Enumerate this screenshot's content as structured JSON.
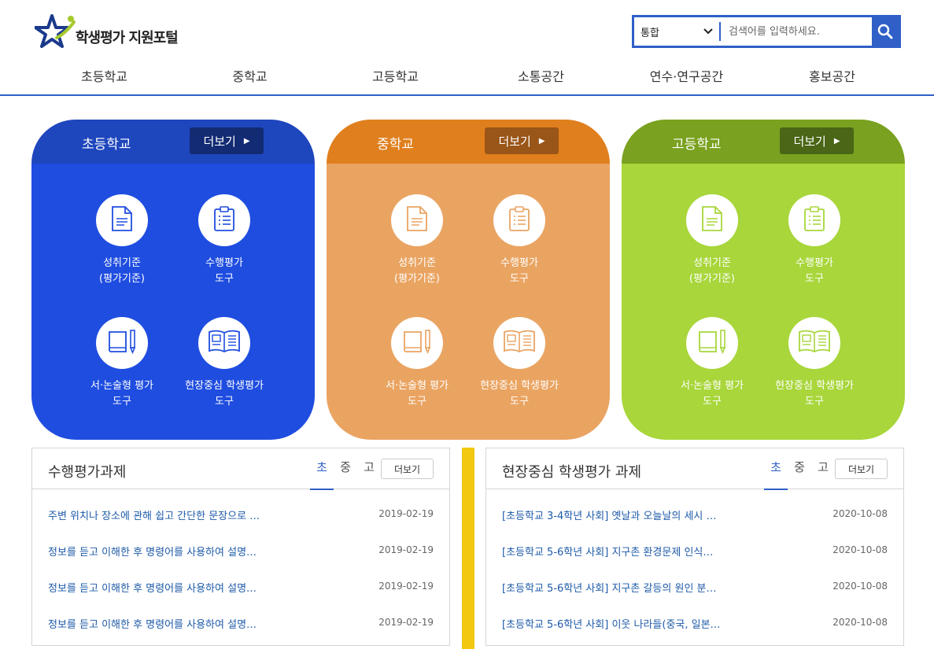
{
  "header": {
    "logo_text": "학생평가 지원포털",
    "search": {
      "category": "통합",
      "placeholder": "검색어를 입력하세요."
    }
  },
  "nav": [
    "초등학교",
    "중학교",
    "고등학교",
    "소통공간",
    "연수·연구공간",
    "홍보공간"
  ],
  "cards": [
    {
      "title": "초등학교",
      "more": "더보기",
      "tiles": [
        {
          "line1": "성취기준",
          "line2": "(평가기준)"
        },
        {
          "line1": "수행평가",
          "line2": "도구"
        },
        {
          "line1": "서·논술형 평가",
          "line2": "도구"
        },
        {
          "line1": "현장중심 학생평가",
          "line2": "도구"
        }
      ]
    },
    {
      "title": "중학교",
      "more": "더보기",
      "tiles": [
        {
          "line1": "성취기준",
          "line2": "(평가기준)"
        },
        {
          "line1": "수행평가",
          "line2": "도구"
        },
        {
          "line1": "서·논술형 평가",
          "line2": "도구"
        },
        {
          "line1": "현장중심 학생평가",
          "line2": "도구"
        }
      ]
    },
    {
      "title": "고등학교",
      "more": "더보기",
      "tiles": [
        {
          "line1": "성취기준",
          "line2": "(평가기준)"
        },
        {
          "line1": "수행평가",
          "line2": "도구"
        },
        {
          "line1": "서·논술형 평가",
          "line2": "도구"
        },
        {
          "line1": "현장중심 학생평가",
          "line2": "도구"
        }
      ]
    }
  ],
  "icon_colors": [
    "#1f4de0",
    "#eaa462",
    "#a8d63b"
  ],
  "boards": [
    {
      "title": "수행평가과제",
      "tabs": [
        "초",
        "중",
        "고"
      ],
      "more": "더보기",
      "items": [
        {
          "text": "주변 위치나 장소에 관해 쉽고 간단한 문장으로 …",
          "date": "2019-02-19"
        },
        {
          "text": "정보를 듣고 이해한 후 명령어를 사용하여 설명…",
          "date": "2019-02-19"
        },
        {
          "text": "정보를 듣고 이해한 후 명령어를 사용하여 설명…",
          "date": "2019-02-19"
        },
        {
          "text": "정보를 듣고 이해한 후 명령어를 사용하여 설명…",
          "date": "2019-02-19"
        }
      ]
    },
    {
      "title": "현장중심 학생평가 과제",
      "tabs": [
        "초",
        "중",
        "고"
      ],
      "more": "더보기",
      "items": [
        {
          "text": "[초등학교 3-4학년 사회] 옛날과 오늘날의 세시 …",
          "date": "2020-10-08"
        },
        {
          "text": "[초등학교 5-6학년 사회] 지구촌 환경문제 인식…",
          "date": "2020-10-08"
        },
        {
          "text": "[초등학교 5-6학년 사회] 지구촌 갈등의 원인 분…",
          "date": "2020-10-08"
        },
        {
          "text": "[초등학교 5-6학년 사회] 이웃 나라들(중국, 일본…",
          "date": "2020-10-08"
        }
      ]
    }
  ]
}
